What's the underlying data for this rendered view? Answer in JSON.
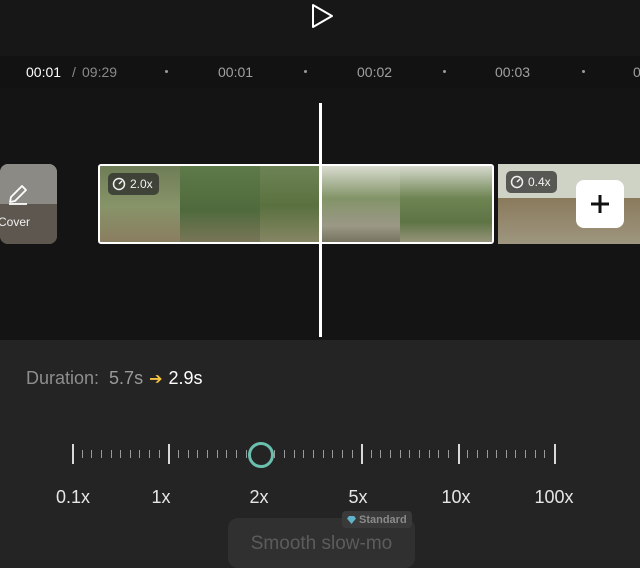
{
  "player": {
    "play_icon": "play-icon"
  },
  "time_ruler": {
    "current": "00:01",
    "separator": "/",
    "total": "09:29",
    "marks": [
      "00:01",
      "00:02",
      "00:03",
      "0"
    ]
  },
  "timeline": {
    "cover_label": "Cover",
    "clip1": {
      "speed": "2.0x"
    },
    "clip2": {
      "speed": "0.4x"
    },
    "add_icon": "plus-icon"
  },
  "speed_panel": {
    "duration_label": "Duration:",
    "duration_original": "5.7s",
    "duration_new": "2.9s",
    "speed_labels": [
      "0.1x",
      "1x",
      "2x",
      "5x",
      "10x",
      "100x"
    ],
    "current_speed": "2x",
    "smooth_slowmo_label": "Smooth slow-mo",
    "standard_badge": "Standard",
    "accent_color": "#6bbfae",
    "arrow_color": "#f6c344"
  }
}
